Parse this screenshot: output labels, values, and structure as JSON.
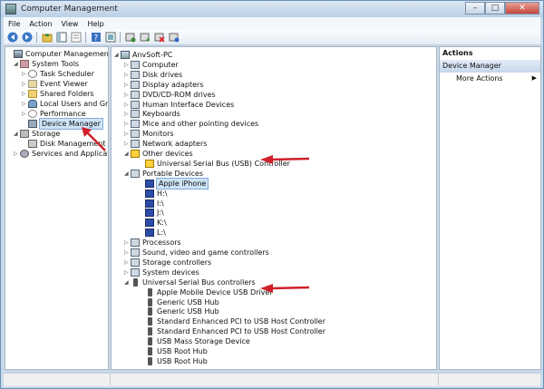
{
  "window": {
    "title": "Computer Management",
    "minimize": "–",
    "maximize": "□",
    "close": "✕"
  },
  "menu": [
    "File",
    "Action",
    "View",
    "Help"
  ],
  "left_tree": [
    {
      "label": "Computer Management (Local",
      "icon": "computer-icon",
      "indent": 0,
      "expander": ""
    },
    {
      "label": "System Tools",
      "icon": "tools-icon",
      "indent": 1,
      "expander": "◢"
    },
    {
      "label": "Task Scheduler",
      "icon": "task-scheduler-icon",
      "indent": 2,
      "expander": "▷"
    },
    {
      "label": "Event Viewer",
      "icon": "event-viewer-icon",
      "indent": 2,
      "expander": "▷"
    },
    {
      "label": "Shared Folders",
      "icon": "shared-folders-icon",
      "indent": 2,
      "expander": "▷"
    },
    {
      "label": "Local Users and Groups",
      "icon": "users-icon",
      "indent": 2,
      "expander": "▷"
    },
    {
      "label": "Performance",
      "icon": "performance-icon",
      "indent": 2,
      "expander": "▷"
    },
    {
      "label": "Device Manager",
      "icon": "device-manager-icon",
      "indent": 2,
      "expander": "",
      "selected": true
    },
    {
      "label": "Storage",
      "icon": "storage-icon",
      "indent": 1,
      "expander": "◢"
    },
    {
      "label": "Disk Management",
      "icon": "disk-icon",
      "indent": 2,
      "expander": ""
    },
    {
      "label": "Services and Applications",
      "icon": "services-icon",
      "indent": 1,
      "expander": "▷"
    }
  ],
  "device_tree": [
    {
      "label": "AnvSoft-PC",
      "icon": "pc-icon",
      "indent": 0,
      "expander": "◢"
    },
    {
      "label": "Computer",
      "icon": "device-icon",
      "indent": 1,
      "expander": "▷"
    },
    {
      "label": "Disk drives",
      "icon": "device-icon",
      "indent": 1,
      "expander": "▷"
    },
    {
      "label": "Display adapters",
      "icon": "device-icon",
      "indent": 1,
      "expander": "▷"
    },
    {
      "label": "DVD/CD-ROM drives",
      "icon": "device-icon",
      "indent": 1,
      "expander": "▷"
    },
    {
      "label": "Human Interface Devices",
      "icon": "device-icon",
      "indent": 1,
      "expander": "▷"
    },
    {
      "label": "Keyboards",
      "icon": "device-icon",
      "indent": 1,
      "expander": "▷"
    },
    {
      "label": "Mice and other pointing devices",
      "icon": "device-icon",
      "indent": 1,
      "expander": "▷"
    },
    {
      "label": "Monitors",
      "icon": "device-icon",
      "indent": 1,
      "expander": "▷"
    },
    {
      "label": "Network adapters",
      "icon": "device-icon",
      "indent": 1,
      "expander": "▷"
    },
    {
      "label": "Other devices",
      "icon": "warning-device-icon",
      "indent": 1,
      "expander": "◢"
    },
    {
      "label": "Universal Serial Bus (USB) Controller",
      "icon": "warning-device-icon",
      "indent": 2,
      "expander": ""
    },
    {
      "label": "Portable Devices",
      "icon": "device-icon",
      "indent": 1,
      "expander": "◢"
    },
    {
      "label": "Apple iPhone",
      "icon": "phone-icon",
      "indent": 2,
      "expander": "",
      "selected": true
    },
    {
      "label": "H:\\",
      "icon": "phone-icon",
      "indent": 2,
      "expander": ""
    },
    {
      "label": "I:\\",
      "icon": "phone-icon",
      "indent": 2,
      "expander": ""
    },
    {
      "label": "J:\\",
      "icon": "phone-icon",
      "indent": 2,
      "expander": ""
    },
    {
      "label": "K:\\",
      "icon": "phone-icon",
      "indent": 2,
      "expander": ""
    },
    {
      "label": "L:\\",
      "icon": "phone-icon",
      "indent": 2,
      "expander": ""
    },
    {
      "label": "Processors",
      "icon": "device-icon",
      "indent": 1,
      "expander": "▷"
    },
    {
      "label": "Sound, video and game controllers",
      "icon": "device-icon",
      "indent": 1,
      "expander": "▷"
    },
    {
      "label": "Storage controllers",
      "icon": "device-icon",
      "indent": 1,
      "expander": "▷"
    },
    {
      "label": "System devices",
      "icon": "device-icon",
      "indent": 1,
      "expander": "▷"
    },
    {
      "label": "Universal Serial Bus controllers",
      "icon": "usb-icon",
      "indent": 1,
      "expander": "◢"
    },
    {
      "label": "Apple Mobile Device USB Driver",
      "icon": "usb-icon",
      "indent": 2,
      "expander": ""
    },
    {
      "label": "Generic USB Hub",
      "icon": "usb-icon",
      "indent": 2,
      "expander": ""
    },
    {
      "label": "Generic USB Hub",
      "icon": "usb-icon",
      "indent": 2,
      "expander": ""
    },
    {
      "label": "Standard Enhanced PCI to USB Host Controller",
      "icon": "usb-icon",
      "indent": 2,
      "expander": ""
    },
    {
      "label": "Standard Enhanced PCI to USB Host Controller",
      "icon": "usb-icon",
      "indent": 2,
      "expander": ""
    },
    {
      "label": "USB Mass Storage Device",
      "icon": "usb-icon",
      "indent": 2,
      "expander": ""
    },
    {
      "label": "USB Root Hub",
      "icon": "usb-icon",
      "indent": 2,
      "expander": ""
    },
    {
      "label": "USB Root Hub",
      "icon": "usb-icon",
      "indent": 2,
      "expander": ""
    }
  ],
  "actions": {
    "title": "Actions",
    "section": "Device Manager",
    "more": "More Actions",
    "more_arrow": "▶"
  },
  "colors": {
    "annotation_arrow": "#d0202a",
    "selection": "#cde3f7",
    "frame": "#c9d9ea"
  }
}
